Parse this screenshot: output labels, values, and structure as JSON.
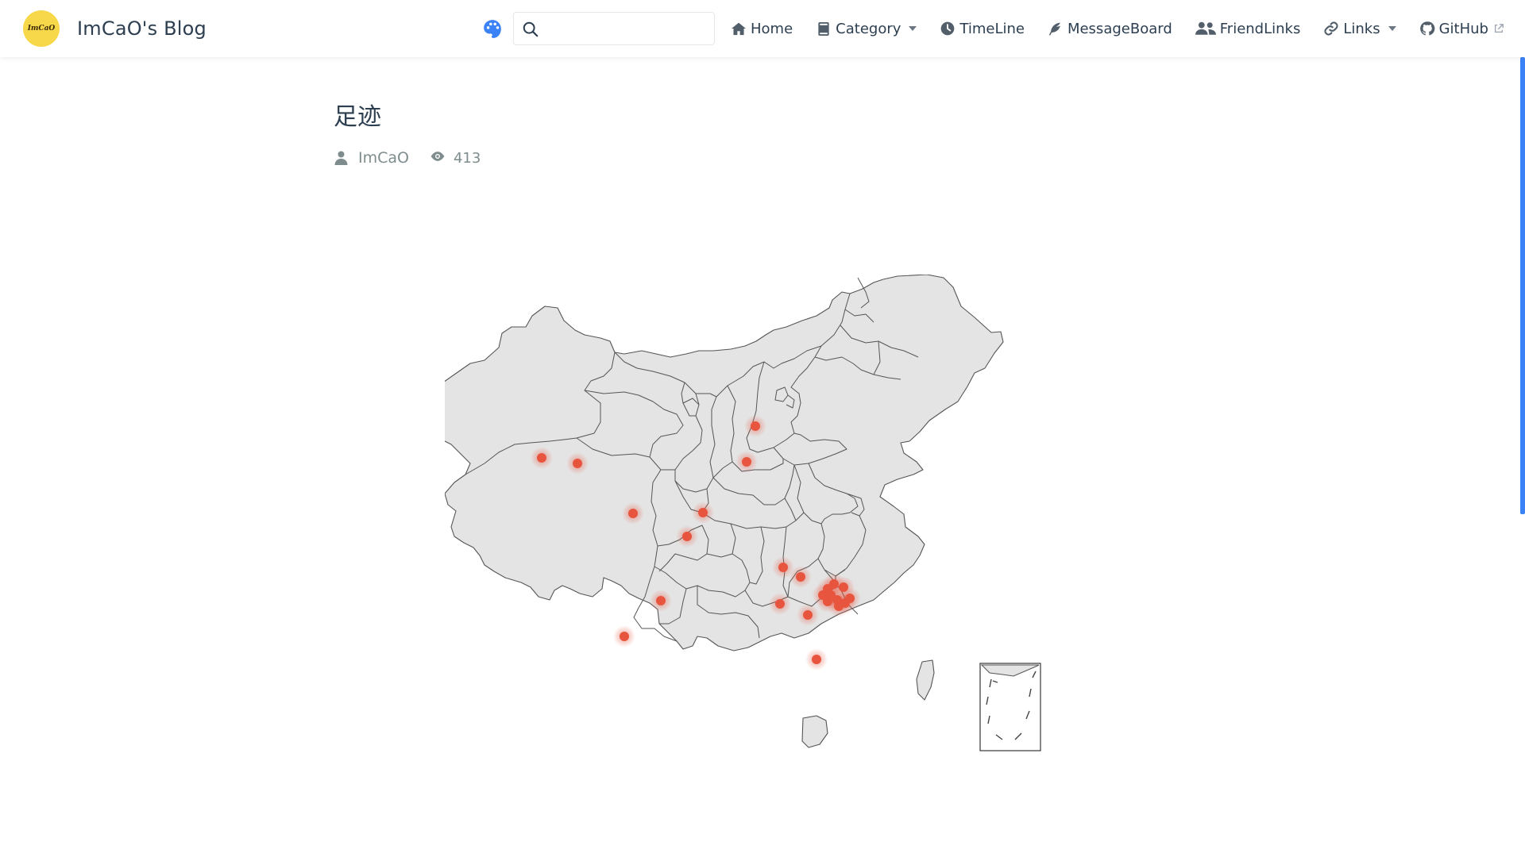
{
  "site": {
    "logo_text": "ImCaO",
    "title": "ImCaO's Blog"
  },
  "search": {
    "value": "",
    "placeholder": ""
  },
  "nav": {
    "items": [
      {
        "label": "Home",
        "icon": "home-icon",
        "dropdown": false
      },
      {
        "label": "Category",
        "icon": "book-icon",
        "dropdown": true
      },
      {
        "label": "TimeLine",
        "icon": "clock-icon",
        "dropdown": false
      },
      {
        "label": "MessageBoard",
        "icon": "feather-icon",
        "dropdown": false
      },
      {
        "label": "FriendLinks",
        "icon": "user-group-icon",
        "dropdown": false
      },
      {
        "label": "Links",
        "icon": "link-icon",
        "dropdown": true
      },
      {
        "label": "GitHub",
        "icon": "github-icon",
        "dropdown": false,
        "external": true
      }
    ]
  },
  "post": {
    "title": "足迹",
    "author": "ImCaO",
    "views": "413"
  },
  "theme": {
    "accent": "#3b82f6",
    "marker_color": "#e8553f",
    "map_fill": "#e4e4e4",
    "logo_bg": "#f7d84b"
  },
  "map": {
    "type": "footprint-map",
    "region": "China",
    "marker_count": 24
  }
}
